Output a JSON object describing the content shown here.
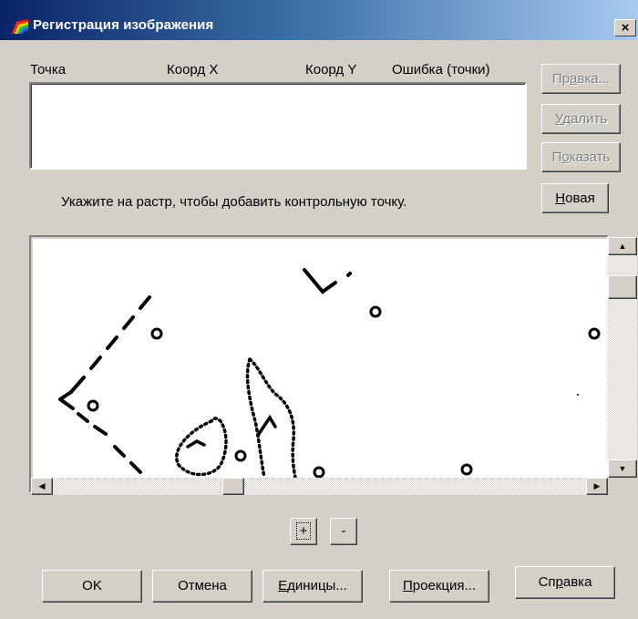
{
  "window": {
    "title": "Регистрация изображения",
    "close_glyph": "×"
  },
  "columns": [
    "Точка",
    "Коорд X",
    "Коорд Y",
    "Ошибка (точки)"
  ],
  "side_buttons": {
    "edit": {
      "pre": "Пр",
      "key": "а",
      "post": "вка..."
    },
    "delete": {
      "pre": "",
      "key": "У",
      "post": "далить"
    },
    "show": {
      "pre": "П",
      "key": "о",
      "post": "казать"
    },
    "new": {
      "pre": "",
      "key": "Н",
      "post": "овая"
    }
  },
  "hint": "Укажите на растр, чтобы добавить контрольную точку.",
  "zoom": {
    "in": "+",
    "out": "-"
  },
  "bottom_buttons": {
    "ok": "OK",
    "cancel": "Отмена",
    "units": {
      "pre": "",
      "key": "Е",
      "post": "диницы..."
    },
    "projection": {
      "pre": "",
      "key": "П",
      "post": "роекция..."
    },
    "help": {
      "pre": "Сп",
      "key": "р",
      "post": "авка"
    }
  },
  "icons": {
    "app": "rainbow-icon",
    "scroll_up": "arrow-up-icon",
    "scroll_down": "arrow-down-icon",
    "scroll_left": "arrow-left-icon",
    "scroll_right": "arrow-right-icon"
  }
}
